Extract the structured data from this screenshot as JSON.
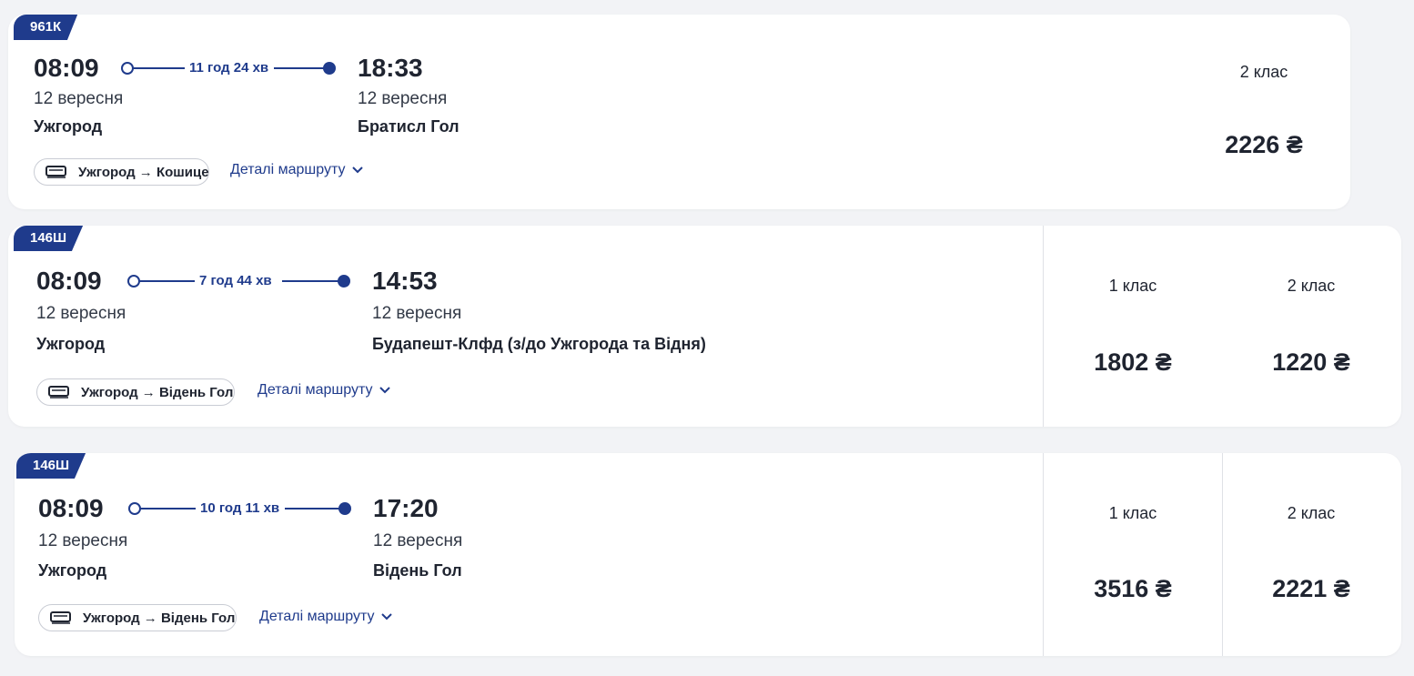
{
  "trips": [
    {
      "train_number": "961К",
      "departure": {
        "time": "08:09",
        "date": "12 вересня",
        "station": "Ужгород"
      },
      "arrival": {
        "time": "18:33",
        "date": "12 вересня",
        "station": "Братисл Гол"
      },
      "duration": "11 год 24 хв",
      "segment_label": "Ужгород → Кошице",
      "details_label": "Деталі маршруту",
      "classes": [
        {
          "label": "2 клас",
          "price": "2226 ₴"
        }
      ]
    },
    {
      "train_number": "146Ш",
      "departure": {
        "time": "08:09",
        "date": "12 вересня",
        "station": "Ужгород"
      },
      "arrival": {
        "time": "14:53",
        "date": "12 вересня",
        "station": "Будапешт-Клфд (з/до Ужгорода та Відня)"
      },
      "duration": "7 год 44 хв",
      "segment_label": "Ужгород → Відень Гол",
      "details_label": "Деталі маршруту",
      "classes": [
        {
          "label": "1 клас",
          "price": "1802 ₴"
        },
        {
          "label": "2 клас",
          "price": "1220 ₴"
        }
      ]
    },
    {
      "train_number": "146Ш",
      "departure": {
        "time": "08:09",
        "date": "12 вересня",
        "station": "Ужгород"
      },
      "arrival": {
        "time": "17:20",
        "date": "12 вересня",
        "station": "Відень Гол"
      },
      "duration": "10 год 11 хв",
      "segment_label": "Ужгород → Відень Гол",
      "details_label": "Деталі маршруту",
      "classes": [
        {
          "label": "1 клас",
          "price": "3516 ₴"
        },
        {
          "label": "2 клас",
          "price": "2221 ₴"
        }
      ]
    }
  ],
  "colors": {
    "accent": "#1f3b8c",
    "text": "#1f2430",
    "background": "#f2f3f6",
    "card": "#ffffff"
  },
  "icons": {
    "train": "train-icon",
    "chevron": "chevron-down-icon"
  }
}
